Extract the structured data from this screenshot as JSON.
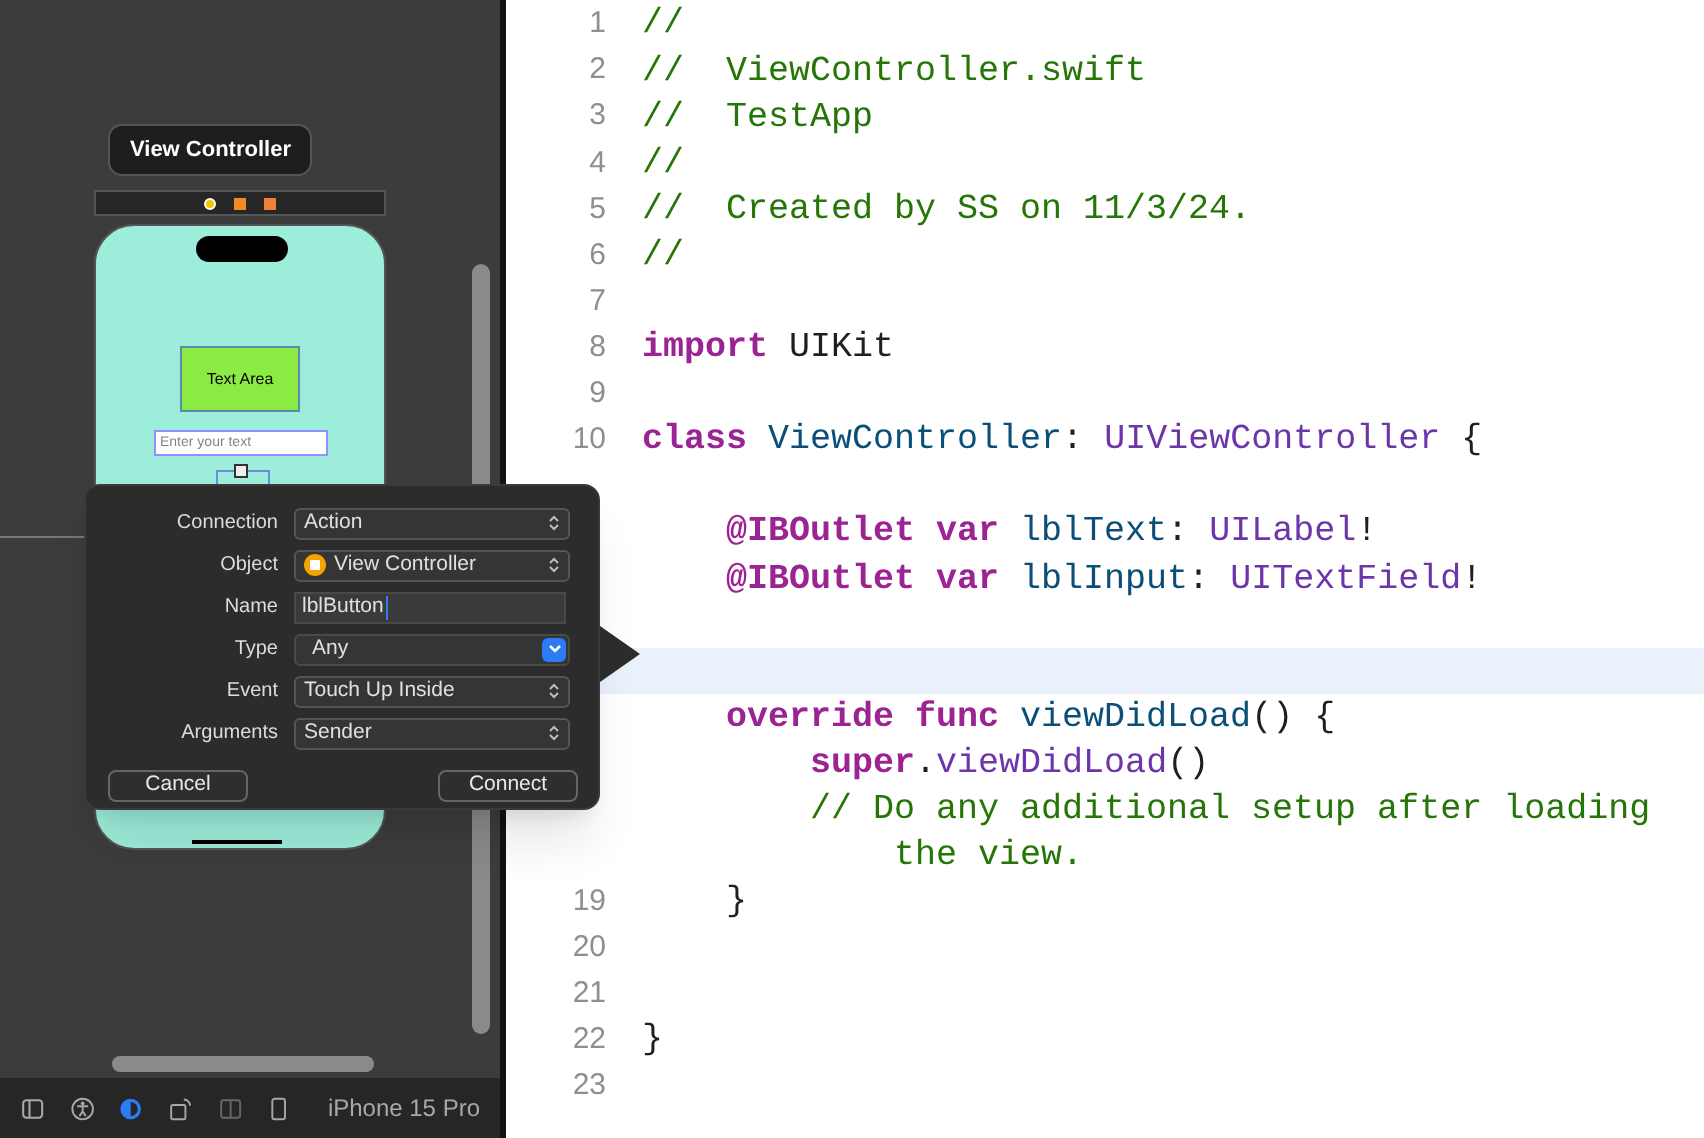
{
  "canvas": {
    "tooltip": "View Controller",
    "scene_dock": [
      {
        "kind": "controller"
      },
      {
        "kind": "responder"
      },
      {
        "kind": "exit"
      }
    ],
    "label": "Text Area",
    "text_field": {
      "placeholder": "Enter your text"
    }
  },
  "popover": {
    "rows": [
      {
        "label": "Connection",
        "kind": "popup",
        "value": "Action"
      },
      {
        "label": "Object",
        "kind": "popup",
        "value": "View Controller",
        "icon": true
      },
      {
        "label": "Name",
        "kind": "text",
        "value": "lblButton"
      },
      {
        "label": "Type",
        "kind": "combo",
        "value": "Any"
      },
      {
        "label": "Event",
        "kind": "popup",
        "value": "Touch Up Inside"
      },
      {
        "label": "Arguments",
        "kind": "popup",
        "value": "Sender"
      }
    ],
    "buttons": [
      "Cancel",
      "Connect"
    ]
  },
  "bottom_bar": {
    "tools": [
      {
        "kind": "sidebar",
        "active": false,
        "disabled": false
      },
      {
        "kind": "accessibility",
        "active": false,
        "disabled": false
      },
      {
        "kind": "appearance",
        "active": true,
        "disabled": false
      },
      {
        "kind": "orientation",
        "active": false,
        "disabled": false
      },
      {
        "kind": "split",
        "active": false,
        "disabled": true
      },
      {
        "kind": "device",
        "active": false,
        "disabled": false
      }
    ],
    "device": "iPhone 15 Pro"
  },
  "editor": {
    "lines": [
      {
        "number": "1",
        "current": false,
        "tokens": [
          {
            "kind": "comment",
            "text": "//"
          }
        ]
      },
      {
        "number": "2",
        "current": false,
        "tokens": [
          {
            "kind": "comment",
            "text": "//  ViewController.swift"
          }
        ]
      },
      {
        "number": "3",
        "current": false,
        "tokens": [
          {
            "kind": "comment",
            "text": "//  TestApp"
          }
        ]
      },
      {
        "number": "4",
        "current": false,
        "tokens": [
          {
            "kind": "comment",
            "text": "//"
          }
        ]
      },
      {
        "number": "5",
        "current": false,
        "tokens": [
          {
            "kind": "comment",
            "text": "//  Created by SS on 11/3/24."
          }
        ]
      },
      {
        "number": "6",
        "current": false,
        "tokens": [
          {
            "kind": "comment",
            "text": "//"
          }
        ]
      },
      {
        "number": "7",
        "current": false
      },
      {
        "number": "8",
        "current": false,
        "tokens": [
          {
            "kind": "keyword",
            "text": "import"
          },
          {
            "kind": "plain",
            "text": " UIKit"
          }
        ]
      },
      {
        "number": "9",
        "current": false
      },
      {
        "number": "10",
        "current": false,
        "tokens": [
          {
            "kind": "keyword",
            "text": "class "
          },
          {
            "kind": "decl",
            "text": "ViewController"
          },
          {
            "kind": "plain",
            "text": ": "
          },
          {
            "kind": "type",
            "text": "UIViewController"
          },
          {
            "kind": "plain",
            "text": " {"
          }
        ]
      },
      {
        "current": false
      },
      {
        "current": false,
        "tokens": [
          {
            "kind": "keyword",
            "text": "    @IBOutlet var "
          },
          {
            "kind": "decl",
            "text": "lblText"
          },
          {
            "kind": "plain",
            "text": ": "
          },
          {
            "kind": "type",
            "text": "UILabel"
          },
          {
            "kind": "plain",
            "text": "!"
          }
        ]
      },
      {
        "current": false,
        "tokens": [
          {
            "kind": "keyword",
            "text": "    @IBOutlet var "
          },
          {
            "kind": "decl",
            "text": "lblInput"
          },
          {
            "kind": "plain",
            "text": ": "
          },
          {
            "kind": "type",
            "text": "UITextField"
          },
          {
            "kind": "plain",
            "text": "!"
          }
        ]
      },
      {
        "current": false
      },
      {
        "current": true
      },
      {
        "current": false,
        "tokens": [
          {
            "kind": "keyword",
            "text": "    override func "
          },
          {
            "kind": "decl",
            "text": "viewDidLoad"
          },
          {
            "kind": "plain",
            "text": "() {"
          }
        ]
      },
      {
        "current": false,
        "tokens": [
          {
            "kind": "keyword",
            "text": "        super"
          },
          {
            "kind": "plain",
            "text": "."
          },
          {
            "kind": "type",
            "text": "viewDidLoad"
          },
          {
            "kind": "plain",
            "text": "()"
          }
        ]
      },
      {
        "current": false,
        "tokens": [
          {
            "kind": "comment",
            "text": "        // Do any additional setup after loading"
          }
        ]
      },
      {
        "current": false,
        "tokens": [
          {
            "kind": "comment",
            "text": "            the view."
          }
        ]
      },
      {
        "number": "19",
        "current": false,
        "tokens": [
          {
            "kind": "plain",
            "text": "    }"
          }
        ]
      },
      {
        "number": "20",
        "current": false
      },
      {
        "number": "21",
        "current": false
      },
      {
        "number": "22",
        "current": false,
        "tokens": [
          {
            "kind": "plain",
            "text": "}"
          }
        ]
      },
      {
        "number": "23",
        "current": false
      }
    ]
  }
}
